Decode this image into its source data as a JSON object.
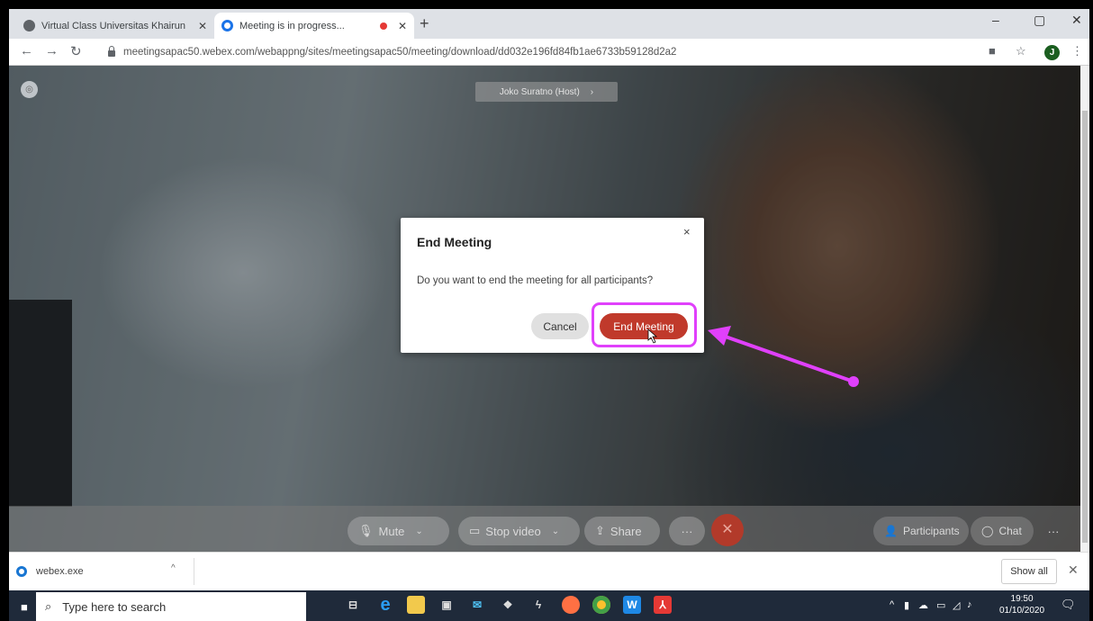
{
  "browser": {
    "tabs": [
      {
        "title": "Virtual Class Universitas Khairun",
        "active": false
      },
      {
        "title": "Meeting is in progress...",
        "active": true,
        "recording": true
      }
    ],
    "url": "meetingsapac50.webex.com/webappng/sites/meetingsapac50/meeting/download/dd032e196fd84fb1ae6733b59128d2a2",
    "profile_initial": "J"
  },
  "meeting": {
    "host_label": "Joko Suratno (Host)",
    "controls": {
      "mute_label": "Mute",
      "stop_video_label": "Stop video",
      "share_label": "Share",
      "more_label": "···",
      "participants_label": "Participants",
      "chat_label": "Chat"
    }
  },
  "dialog": {
    "title": "End Meeting",
    "message": "Do you want to end the meeting for all participants?",
    "cancel_label": "Cancel",
    "confirm_label": "End Meeting"
  },
  "download_bar": {
    "file_name": "webex.exe",
    "show_all_label": "Show all"
  },
  "taskbar": {
    "search_placeholder": "Type here to search",
    "time": "19:50",
    "date": "01/10/2020"
  },
  "colors": {
    "highlight": "#e040fb",
    "end_meeting_button": "#c0392b"
  }
}
